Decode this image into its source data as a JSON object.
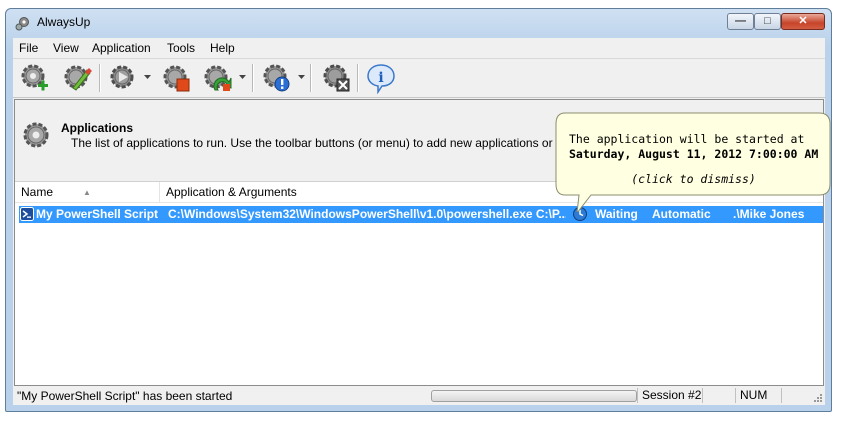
{
  "window": {
    "title": "AlwaysUp"
  },
  "menu": {
    "items": [
      "File",
      "View",
      "Application",
      "Tools",
      "Help"
    ]
  },
  "toolbar": {
    "buttons": [
      "add-application-icon",
      "edit-application-icon",
      "start-application-icon",
      "stop-application-icon",
      "restart-application-icon",
      "report-icon",
      "remove-application-icon",
      "help-icon"
    ]
  },
  "header": {
    "title": "Applications",
    "description": "The list of applications to run. Use the toolbar buttons (or menu) to add new applications or change yo"
  },
  "table": {
    "columns": [
      "Name",
      "Application & Arguments"
    ],
    "rows": [
      {
        "name": "My PowerShell Script",
        "application": "C:\\Windows\\System32\\WindowsPowerShell\\v1.0\\powershell.exe C:\\P...",
        "state": "Waiting",
        "startup": "Automatic",
        "user": ".\\Mike Jones"
      }
    ]
  },
  "tooltip": {
    "line1": "The application will be started at",
    "line2": "Saturday, August 11, 2012 7:00:00 AM",
    "line3": "(click to dismiss)"
  },
  "statusbar": {
    "message": "\"My PowerShell Script\" has been started",
    "session": "Session #2",
    "num": "NUM"
  },
  "colors": {
    "selection": "#3399ff",
    "tooltip_bg": "#ffffe1"
  }
}
